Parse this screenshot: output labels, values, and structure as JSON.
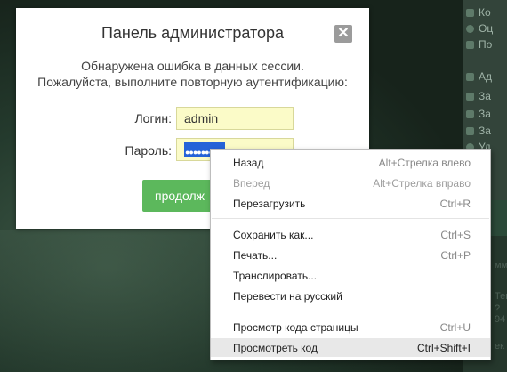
{
  "modal": {
    "title": "Панель администратора",
    "message_line1": "Обнаружена ошибка в данных сессии.",
    "message_line2": "Пожалуйста, выполните повторную аутентификацию:",
    "login_label": "Логин:",
    "login_value": "admin",
    "password_label": "Пароль:",
    "password_mask": "●●●●●●●●●",
    "continue_label": "продолж",
    "close_icon": "close-icon"
  },
  "context_menu": {
    "items": [
      {
        "label": "Назад",
        "shortcut": "Alt+Стрелка влево",
        "enabled": true
      },
      {
        "label": "Вперед",
        "shortcut": "Alt+Стрелка вправо",
        "enabled": false
      },
      {
        "label": "Перезагрузить",
        "shortcut": "Ctrl+R",
        "enabled": true
      },
      {
        "label": "Сохранить как...",
        "shortcut": "Ctrl+S",
        "enabled": true
      },
      {
        "label": "Печать...",
        "shortcut": "Ctrl+P",
        "enabled": true
      },
      {
        "label": "Транслировать...",
        "shortcut": "",
        "enabled": true
      },
      {
        "label": "Перевести на русский",
        "shortcut": "",
        "enabled": true
      },
      {
        "label": "Просмотр кода страницы",
        "shortcut": "Ctrl+U",
        "enabled": true
      },
      {
        "label": "Просмотреть код",
        "shortcut": "Ctrl+Shift+I",
        "enabled": true,
        "highlighted": true
      }
    ]
  },
  "sidebar": {
    "items": [
      {
        "label": "Ко"
      },
      {
        "label": "Оц"
      },
      {
        "label": "По"
      },
      {
        "label": "Ад"
      },
      {
        "label": "За"
      },
      {
        "label": "За"
      },
      {
        "label": "За"
      },
      {
        "label": "Уд"
      }
    ],
    "fragments": [
      "ммь",
      "Тек",
      "?94",
      "ек"
    ]
  },
  "colors": {
    "continue_button": "#5cb85c",
    "selection": "#2563d8",
    "input_bg": "#fbfbc8",
    "menu_highlight": "#e8e8e8"
  }
}
